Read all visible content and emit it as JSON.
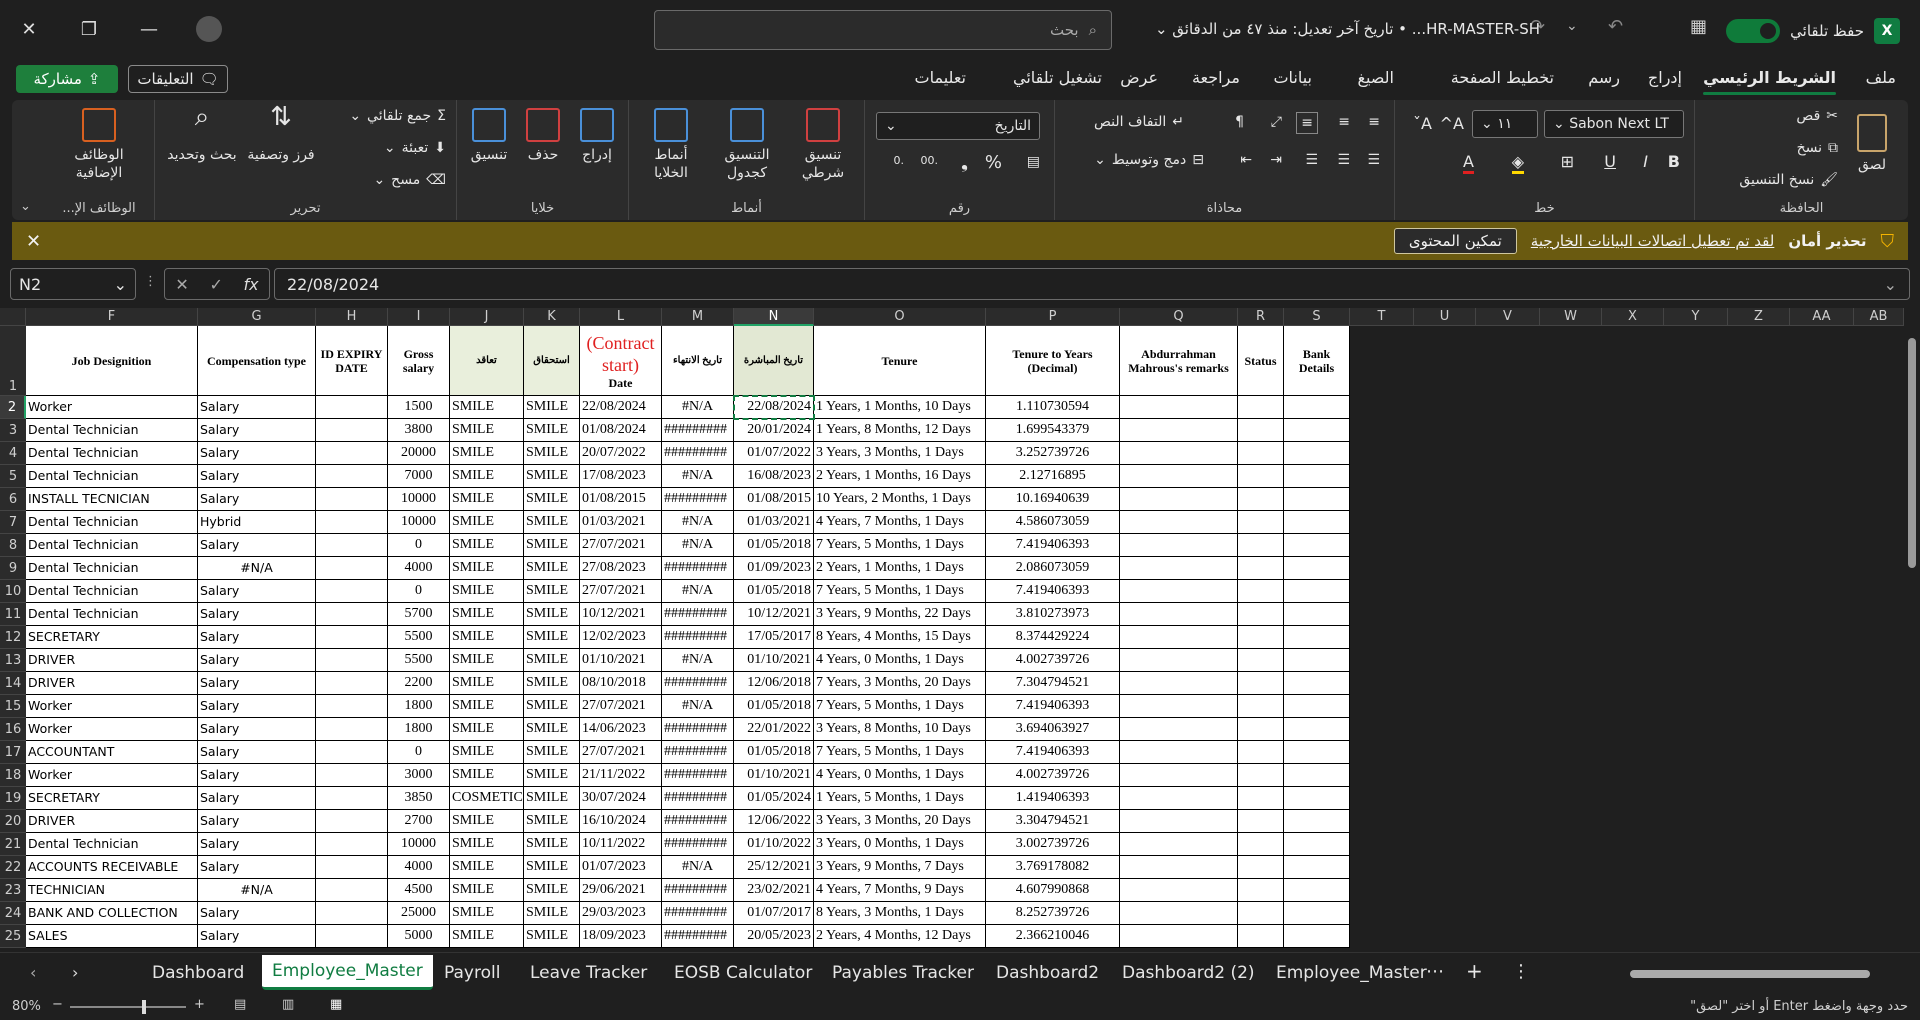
{
  "titlebar": {
    "search_placeholder": "بحث",
    "doc_title": "HR-MASTER-SH... • تاريخ آخر تعديل: منذ ٤٧ من الدقائق",
    "autosave_label": "حفظ تلقائي"
  },
  "ribbon_tabs": [
    "ملف",
    "الشريط الرئيسي",
    "إدراج",
    "رسم",
    "تخطيط الصفحة",
    "الصيغ",
    "بيانات",
    "مراجعة",
    "عرض",
    "تشغيل تلقائي",
    "تعليمات"
  ],
  "share_label": "مشاركة",
  "comments_label": "التعليقات",
  "ribbon": {
    "clipboard": {
      "label": "الحافظة",
      "paste": "لصق",
      "cut": "قص",
      "copy": "نسخ",
      "format_painter": "نسخ التنسيق"
    },
    "font": {
      "label": "خط",
      "name": "Sabon Next LT",
      "size": "١١"
    },
    "alignment": {
      "label": "محاذاة",
      "wrap": "التفاف النص",
      "merge": "دمج وتوسيط"
    },
    "number": {
      "label": "رقم",
      "format": "التاريخ"
    },
    "styles": {
      "label": "أنماط",
      "conditional": "تنسيق شرطي",
      "as_table": "التنسيق كجدول",
      "cell_styles": "أنماط الخلايا"
    },
    "cells": {
      "label": "خلايا",
      "insert": "إدراج",
      "delete": "حذف",
      "format": "تنسيق"
    },
    "editing": {
      "label": "تحرير",
      "autosum": "جمع تلقائي",
      "fill": "تعبئة",
      "clear": "مسح",
      "sort": "فرز وتصفية",
      "find": "بحث وتحديد"
    },
    "addins": {
      "label": "الوظائف الإ...",
      "addins": "الوظائف الإضافية"
    }
  },
  "security_bar": {
    "title": "تحذير أمان",
    "message": "لقد تم تعطيل اتصالات البيانات الخارجية",
    "button": "تمكين المحتوى"
  },
  "formula_bar": {
    "name_box": "N2",
    "formula": "22/08/2024"
  },
  "columns": [
    "F",
    "G",
    "H",
    "I",
    "J",
    "K",
    "L",
    "M",
    "N",
    "O",
    "P",
    "Q",
    "R",
    "S",
    "T",
    "U",
    "V",
    "W",
    "X",
    "Y",
    "Z",
    "AA",
    "AB"
  ],
  "headers": {
    "F": "Job Designition",
    "G": "Compensation type",
    "H": "ID EXPIRY DATE",
    "I": "Gross salary",
    "J": "تعاقد",
    "K": "استحقاق",
    "L_red": "(Contract start)",
    "L_sub": "Date",
    "M": "تاريخ الانتهاء",
    "N": "تاريخ المباشرة",
    "O": "Tenure",
    "P": "Tenure to Years (Decimal)",
    "Q": "Abdurrahman Mahrous's remarks",
    "R": "Status",
    "S": "Bank Details"
  },
  "rows": [
    [
      "2",
      "Worker",
      "Salary",
      "",
      "1500",
      "SMILE",
      "SMILE",
      "22/08/2024",
      "#N/A",
      "22/08/2024",
      "1 Years, 1 Months, 10 Days",
      "1.110730594"
    ],
    [
      "3",
      "Dental Technician",
      "Salary",
      "",
      "3800",
      "SMILE",
      "SMILE",
      "01/08/2024",
      "#########",
      "20/01/2024",
      "1 Years, 8 Months, 12 Days",
      "1.699543379"
    ],
    [
      "4",
      "Dental Technician",
      "Salary",
      "",
      "20000",
      "SMILE",
      "SMILE",
      "20/07/2022",
      "#########",
      "01/07/2022",
      "3 Years, 3 Months, 1 Days",
      "3.252739726"
    ],
    [
      "5",
      "Dental Technician",
      "Salary",
      "",
      "7000",
      "SMILE",
      "SMILE",
      "17/08/2023",
      "#N/A",
      "16/08/2023",
      "2 Years, 1 Months, 16 Days",
      "2.12716895"
    ],
    [
      "6",
      "INSTALL TECNICIAN",
      "Salary",
      "",
      "10000",
      "SMILE",
      "SMILE",
      "01/08/2015",
      "#########",
      "01/08/2015",
      "10 Years, 2 Months, 1 Days",
      "10.16940639"
    ],
    [
      "7",
      "Dental Technician",
      "Hybrid",
      "",
      "10000",
      "SMILE",
      "SMILE",
      "01/03/2021",
      "#N/A",
      "01/03/2021",
      "4 Years, 7 Months, 1 Days",
      "4.586073059"
    ],
    [
      "8",
      "Dental Technician",
      "Salary",
      "",
      "0",
      "SMILE",
      "SMILE",
      "27/07/2021",
      "#N/A",
      "01/05/2018",
      "7 Years, 5 Months, 1 Days",
      "7.419406393"
    ],
    [
      "9",
      "Dental Technician",
      "#N/A",
      "",
      "4000",
      "SMILE",
      "SMILE",
      "27/08/2023",
      "#########",
      "01/09/2023",
      "2 Years, 1 Months, 1 Days",
      "2.086073059"
    ],
    [
      "10",
      "Dental Technician",
      "Salary",
      "",
      "0",
      "SMILE",
      "SMILE",
      "27/07/2021",
      "#N/A",
      "01/05/2018",
      "7 Years, 5 Months, 1 Days",
      "7.419406393"
    ],
    [
      "11",
      "Dental Technician",
      "Salary",
      "",
      "5700",
      "SMILE",
      "SMILE",
      "10/12/2021",
      "#########",
      "10/12/2021",
      "3 Years, 9 Months, 22 Days",
      "3.810273973"
    ],
    [
      "12",
      "SECRETARY",
      "Salary",
      "",
      "5500",
      "SMILE",
      "SMILE",
      "12/02/2023",
      "#########",
      "17/05/2017",
      "8 Years, 4 Months, 15 Days",
      "8.374429224"
    ],
    [
      "13",
      "DRIVER",
      "Salary",
      "",
      "5500",
      "SMILE",
      "SMILE",
      "01/10/2021",
      "#N/A",
      "01/10/2021",
      "4 Years, 0 Months, 1 Days",
      "4.002739726"
    ],
    [
      "14",
      "DRIVER",
      "Salary",
      "",
      "2200",
      "SMILE",
      "SMILE",
      "08/10/2018",
      "#########",
      "12/06/2018",
      "7 Years, 3 Months, 20 Days",
      "7.304794521"
    ],
    [
      "15",
      "Worker",
      "Salary",
      "",
      "1800",
      "SMILE",
      "SMILE",
      "27/07/2021",
      "#N/A",
      "01/05/2018",
      "7 Years, 5 Months, 1 Days",
      "7.419406393"
    ],
    [
      "16",
      "Worker",
      "Salary",
      "",
      "1800",
      "SMILE",
      "SMILE",
      "14/06/2023",
      "#########",
      "22/01/2022",
      "3 Years, 8 Months, 10 Days",
      "3.694063927"
    ],
    [
      "17",
      "ACCOUNTANT",
      "Salary",
      "",
      "0",
      "SMILE",
      "SMILE",
      "27/07/2021",
      "#########",
      "01/05/2018",
      "7 Years, 5 Months, 1 Days",
      "7.419406393"
    ],
    [
      "18",
      "Worker",
      "Salary",
      "",
      "3000",
      "SMILE",
      "SMILE",
      "21/11/2022",
      "#########",
      "01/10/2021",
      "4 Years, 0 Months, 1 Days",
      "4.002739726"
    ],
    [
      "19",
      "SECRETARY",
      "Salary",
      "",
      "3850",
      "COSMETIC",
      "SMILE",
      "30/07/2024",
      "#########",
      "01/05/2024",
      "1 Years, 5 Months, 1 Days",
      "1.419406393"
    ],
    [
      "20",
      "DRIVER",
      "Salary",
      "",
      "2700",
      "SMILE",
      "SMILE",
      "16/10/2024",
      "#########",
      "12/06/2022",
      "3 Years, 3 Months, 20 Days",
      "3.304794521"
    ],
    [
      "21",
      "Dental Technician",
      "Salary",
      "",
      "10000",
      "SMILE",
      "SMILE",
      "10/11/2022",
      "#########",
      "01/10/2022",
      "3 Years, 0 Months, 1 Days",
      "3.002739726"
    ],
    [
      "22",
      "ACCOUNTS RECEIVABLE",
      "Salary",
      "",
      "4000",
      "SMILE",
      "SMILE",
      "01/07/2023",
      "#N/A",
      "25/12/2021",
      "3 Years, 9 Months, 7 Days",
      "3.769178082"
    ],
    [
      "23",
      "TECHNICIAN",
      "#N/A",
      "",
      "4500",
      "SMILE",
      "SMILE",
      "29/06/2021",
      "#########",
      "23/02/2021",
      "4 Years, 7 Months, 9 Days",
      "4.607990868"
    ],
    [
      "24",
      "BANK AND COLLECTION",
      "Salary",
      "",
      "25000",
      "SMILE",
      "SMILE",
      "29/03/2023",
      "#########",
      "01/07/2017",
      "8 Years, 3 Months, 1 Days",
      "8.252739726"
    ],
    [
      "25",
      "SALES",
      "Salary",
      "",
      "5000",
      "SMILE",
      "SMILE",
      "18/09/2023",
      "#########",
      "20/05/2023",
      "2 Years, 4 Months, 12 Days",
      "2.366210046"
    ]
  ],
  "sheet_tabs": [
    "Dashboard",
    "Employee_Master",
    "Payroll",
    "Leave Tracker",
    "EOSB Calculator",
    "Payables Tracker",
    "Dashboard2",
    "Dashboard2 (2)",
    "Employee_Master"
  ],
  "status": {
    "zoom": "80%",
    "message": "حدد وجهة واضغط Enter أو اختر \"لصق\""
  }
}
